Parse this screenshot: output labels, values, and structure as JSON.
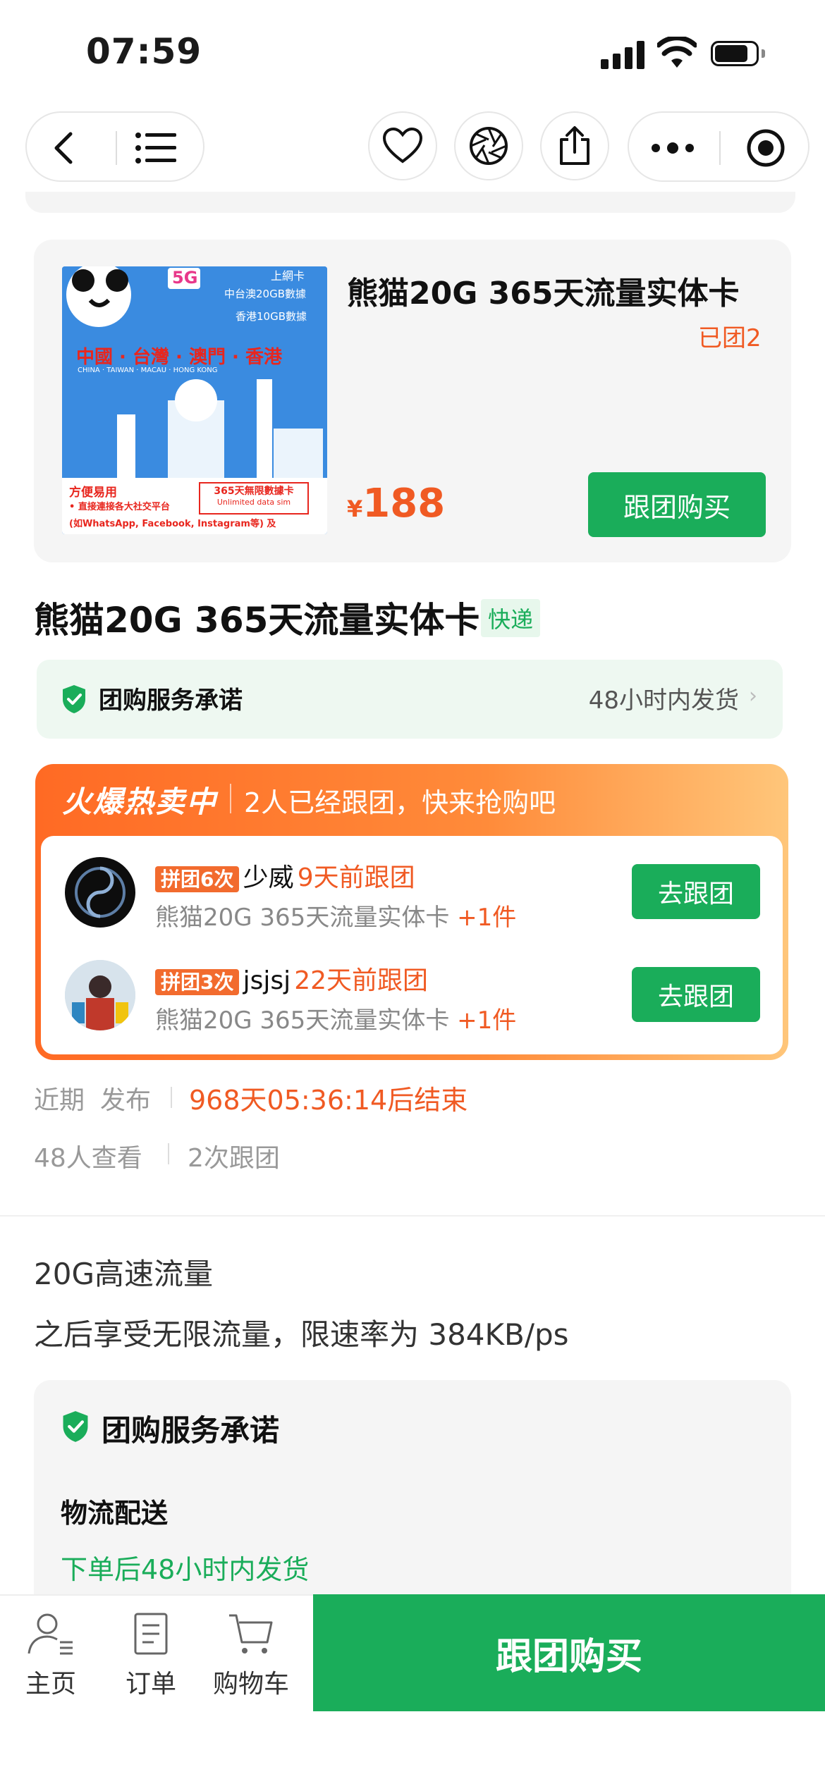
{
  "status_bar": {
    "time": "07:59"
  },
  "product_card": {
    "title": "熊猫20G 365天流量实体卡",
    "joined": "已团2",
    "price_currency": "¥",
    "price": "188",
    "buy_label": "跟团购买",
    "image": {
      "top_tag": "上網卡",
      "line1": "中台澳20GB數據",
      "line2": "香港10GB數據",
      "regions": "中國 · 台灣 · 澳門 · 香港",
      "regions_en": "CHINA · TAIWAN · MACAU · HONG KONG",
      "easy": "方便易用",
      "bullet": "• 直接連接各大社交平台",
      "bullet2": "(如WhatsApp, Facebook, Instagram等) 及",
      "box1": "365天無限數據卡",
      "box2": "Unlimited data sim",
      "badge5g": "5G"
    }
  },
  "main": {
    "title": "熊猫20G 365天流量实体卡",
    "tag": "快递",
    "service": {
      "label": "团购服务承诺",
      "right": "48小时内发货"
    }
  },
  "hot": {
    "title": "火爆热卖中",
    "subtitle": "2人已经跟团，快来抢购吧",
    "entries": [
      {
        "badge": "拼团6次",
        "name": "少威",
        "time": "9天前跟团",
        "item": "熊猫20G 365天流量实体卡",
        "qty": "+1件",
        "btn": "去跟团"
      },
      {
        "badge": "拼团3次",
        "name": "jsjsj",
        "time": "22天前跟团",
        "item": "熊猫20G 365天流量实体卡",
        "qty": "+1件",
        "btn": "去跟团"
      }
    ]
  },
  "meta": {
    "recent": "近期",
    "publish": "发布",
    "countdown": "968天05:36:14后结束",
    "views": "48人查看",
    "joins": "2次跟团"
  },
  "desc": {
    "line1": "20G高速流量",
    "line2": "之后享受无限流量，限速率为 384KB/ps"
  },
  "promise": {
    "title": "团购服务承诺",
    "logistics": "物流配送",
    "ship": "下单后48小时内发货"
  },
  "bottom": {
    "tabs": [
      "主页",
      "订单",
      "购物车"
    ],
    "buy": "跟团购买"
  },
  "colors": {
    "green": "#1aad5a",
    "orange": "#f05a23"
  }
}
